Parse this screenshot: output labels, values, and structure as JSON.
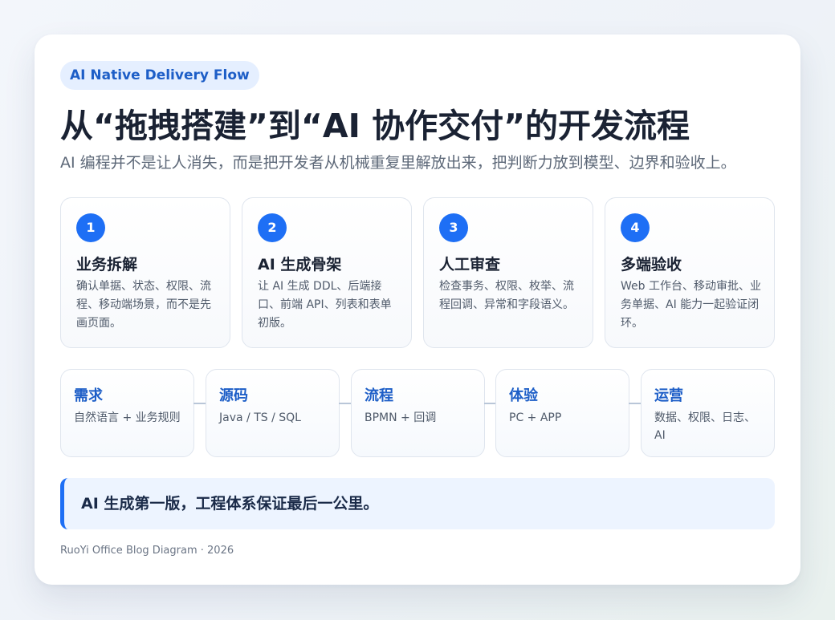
{
  "badge": "AI Native Delivery Flow",
  "title": "从“拖拽搭建”到“AI 协作交付”的开发流程",
  "subtitle": "AI 编程并不是让人消失，而是把开发者从机械重复里解放出来，把判断力放到模型、边界和验收上。",
  "steps": [
    {
      "num": "1",
      "title": "业务拆解",
      "desc": "确认单据、状态、权限、流程、移动端场景，而不是先画页面。"
    },
    {
      "num": "2",
      "title": "AI 生成骨架",
      "desc": "让 AI 生成 DDL、后端接口、前端 API、列表和表单初版。"
    },
    {
      "num": "3",
      "title": "人工审查",
      "desc": "检查事务、权限、枚举、流程回调、异常和字段语义。"
    },
    {
      "num": "4",
      "title": "多端验收",
      "desc": "Web 工作台、移动审批、业务单据、AI 能力一起验证闭环。"
    }
  ],
  "flow": [
    {
      "title": "需求",
      "desc": "自然语言 + 业务规则"
    },
    {
      "title": "源码",
      "desc": "Java / TS / SQL"
    },
    {
      "title": "流程",
      "desc": "BPMN + 回调"
    },
    {
      "title": "体验",
      "desc": "PC + APP"
    },
    {
      "title": "运营",
      "desc": "数据、权限、日志、AI"
    }
  ],
  "callout": "AI 生成第一版，工程体系保证最后一公里。",
  "footer": "RuoYi Office Blog Diagram · 2026",
  "colors": {
    "accent": "#1e6ff5",
    "accent_text": "#1d5ec7",
    "callout_bg": "#edf4ff"
  }
}
